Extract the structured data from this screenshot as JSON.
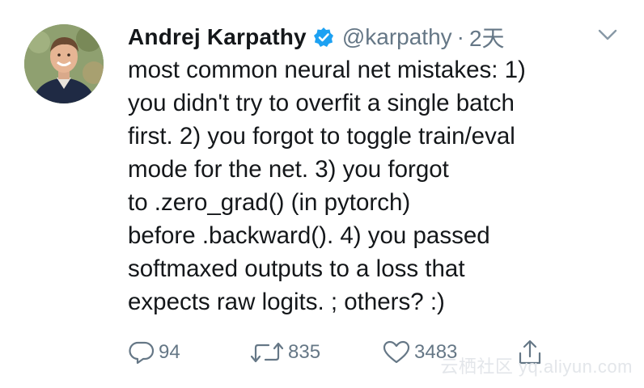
{
  "author": {
    "name": "Andrej Karpathy",
    "handle": "@karpathy",
    "separator": "·",
    "time": "2天"
  },
  "tweet": {
    "lines": [
      "most common neural net mistakes: 1)",
      "you didn't try to overfit a single batch",
      "first. 2) you forgot to toggle train/eval",
      "mode for the net. 3) you forgot",
      "to .zero_grad() (in pytorch)",
      "before .backward(). 4) you passed",
      "softmaxed outputs to a loss that",
      "expects raw logits. ; others? :)"
    ]
  },
  "actions": {
    "replies": "94",
    "retweets": "835",
    "likes": "3483"
  },
  "icons": {
    "verified": "verified-badge-icon",
    "menu": "chevron-down-icon",
    "reply": "reply-icon",
    "retweet": "retweet-icon",
    "like": "heart-icon",
    "share": "share-icon"
  },
  "colors": {
    "text": "#14171a",
    "secondary": "#657786",
    "verified": "#1da1f2"
  },
  "watermark": "云栖社区 yq.aliyun.com"
}
